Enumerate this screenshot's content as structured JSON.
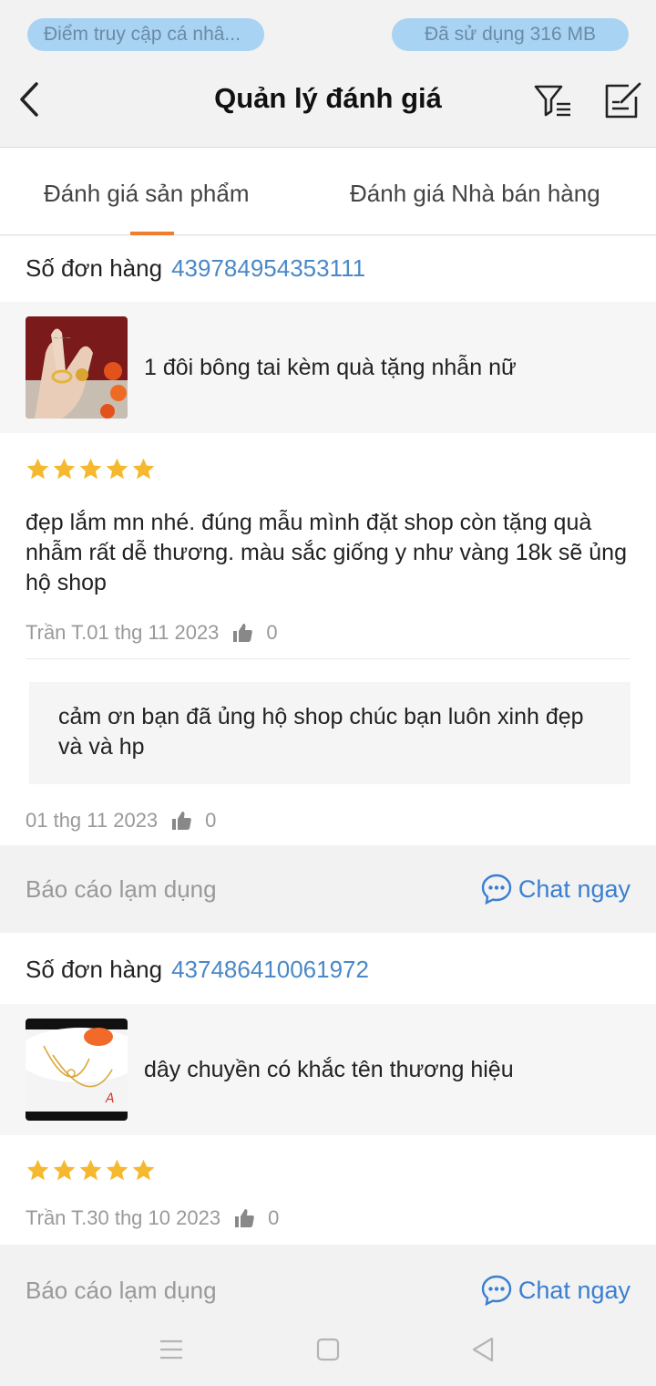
{
  "status": {
    "left_pill": "Điểm truy cập cá nhâ...",
    "right_pill": "Đã sử dụng  316 MB"
  },
  "header": {
    "title": "Quản lý đánh giá",
    "back_icon": "chevron-left-icon",
    "filter_icon": "filter-list-icon",
    "edit_icon": "edit-note-icon"
  },
  "tabs": [
    {
      "label": "Đánh giá sản phẩm",
      "active": true
    },
    {
      "label": "Đánh giá Nhà bán hàng",
      "active": false
    }
  ],
  "colors": {
    "accent": "#f07f2d",
    "link": "#4a88c7",
    "star": "#f5b82e",
    "chat": "#3a7fd0"
  },
  "reviews": [
    {
      "order_label": "Số đơn hàng",
      "order_number": "439784954353111",
      "product_name": "1 đôi bông tai kèm quà tặng nhẫn nữ",
      "rating": 5,
      "text": "đẹp lắm mn nhé. đúng mẫu mình đặt shop còn tặng quà nhẫm rất dễ thương.  màu sắc giống y như vàng 18k sẽ ủng hộ shop",
      "author_date": "Trần T.01 thg 11 2023",
      "likes": "0",
      "reply": {
        "text": "cảm ơn bạn đã ủng hộ shop chúc bạn luôn xinh đẹp và và hp",
        "date": "01 thg 11 2023",
        "likes": "0"
      },
      "report_label": "Báo cáo lạm dụng",
      "chat_label": "Chat ngay"
    },
    {
      "order_label": "Số đơn hàng",
      "order_number": "437486410061972",
      "product_name": "dây chuyền có khắc tên thương hiệu",
      "rating": 5,
      "author_date": "Trần T.30 thg 10 2023",
      "likes": "0",
      "report_label": "Báo cáo lạm dụng",
      "chat_label": "Chat ngay"
    }
  ]
}
